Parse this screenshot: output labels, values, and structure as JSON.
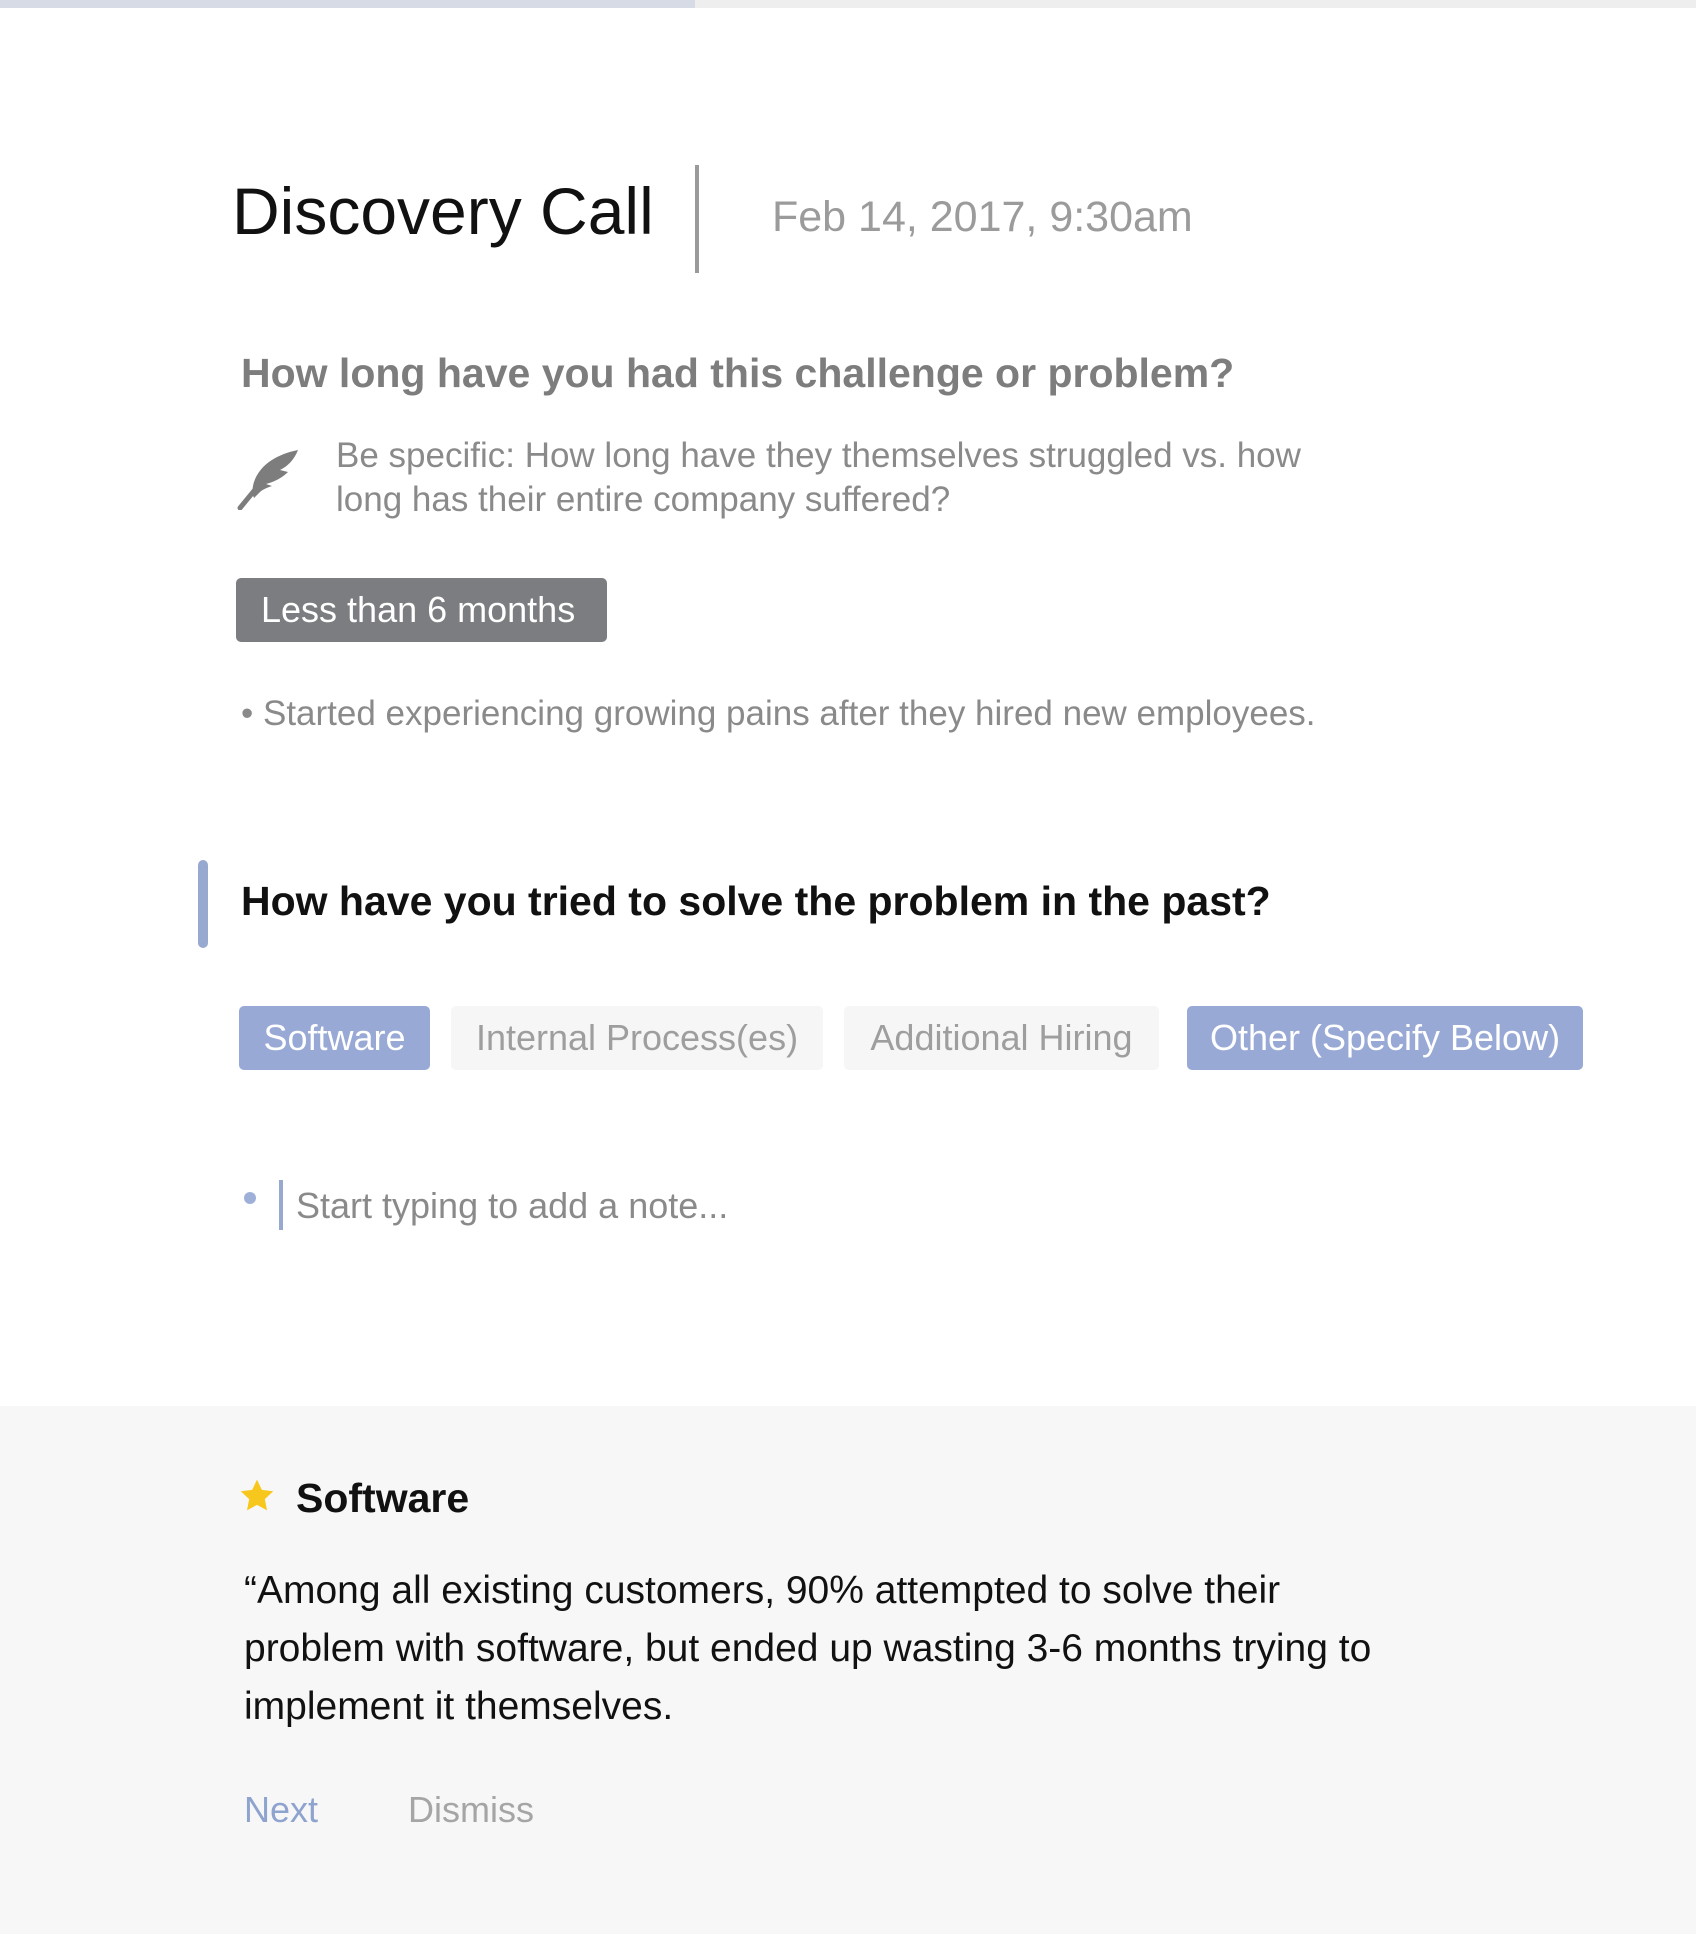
{
  "progress": {
    "fraction": 0.41,
    "color": "#d6dbe6"
  },
  "header": {
    "title": "Discovery Call",
    "datetime": "Feb 14, 2017, 9:30am"
  },
  "question1": {
    "text": "How long have you had this challenge or problem?",
    "hint_icon": "feather-icon",
    "hint": "Be specific: How long have they themselves struggled vs. how long has their entire company suffered?",
    "answer": "Less than 6 months",
    "note": "• Started experiencing growing pains after they hired new employees."
  },
  "question2": {
    "text": "How have you tried to solve the problem in the past?",
    "options": [
      {
        "label": "Software",
        "selected": true
      },
      {
        "label": "Internal Process(es)",
        "selected": false
      },
      {
        "label": "Additional Hiring",
        "selected": false
      },
      {
        "label": "Other (Specify Below)",
        "selected": true
      }
    ],
    "note_placeholder": "Start typing to add a note..."
  },
  "tip": {
    "icon": "star-icon",
    "star_color": "#f7c71e",
    "title": "Software",
    "quote": "“Among all existing customers, 90% attempted to solve their problem with software, but ended up wasting 3-6 months trying to implement it themselves.",
    "next_label": "Next",
    "dismiss_label": "Dismiss"
  },
  "colors": {
    "accent": "#98a9d5",
    "answer_chip": "#7c7d80",
    "panel_bg": "#f7f7f7"
  }
}
